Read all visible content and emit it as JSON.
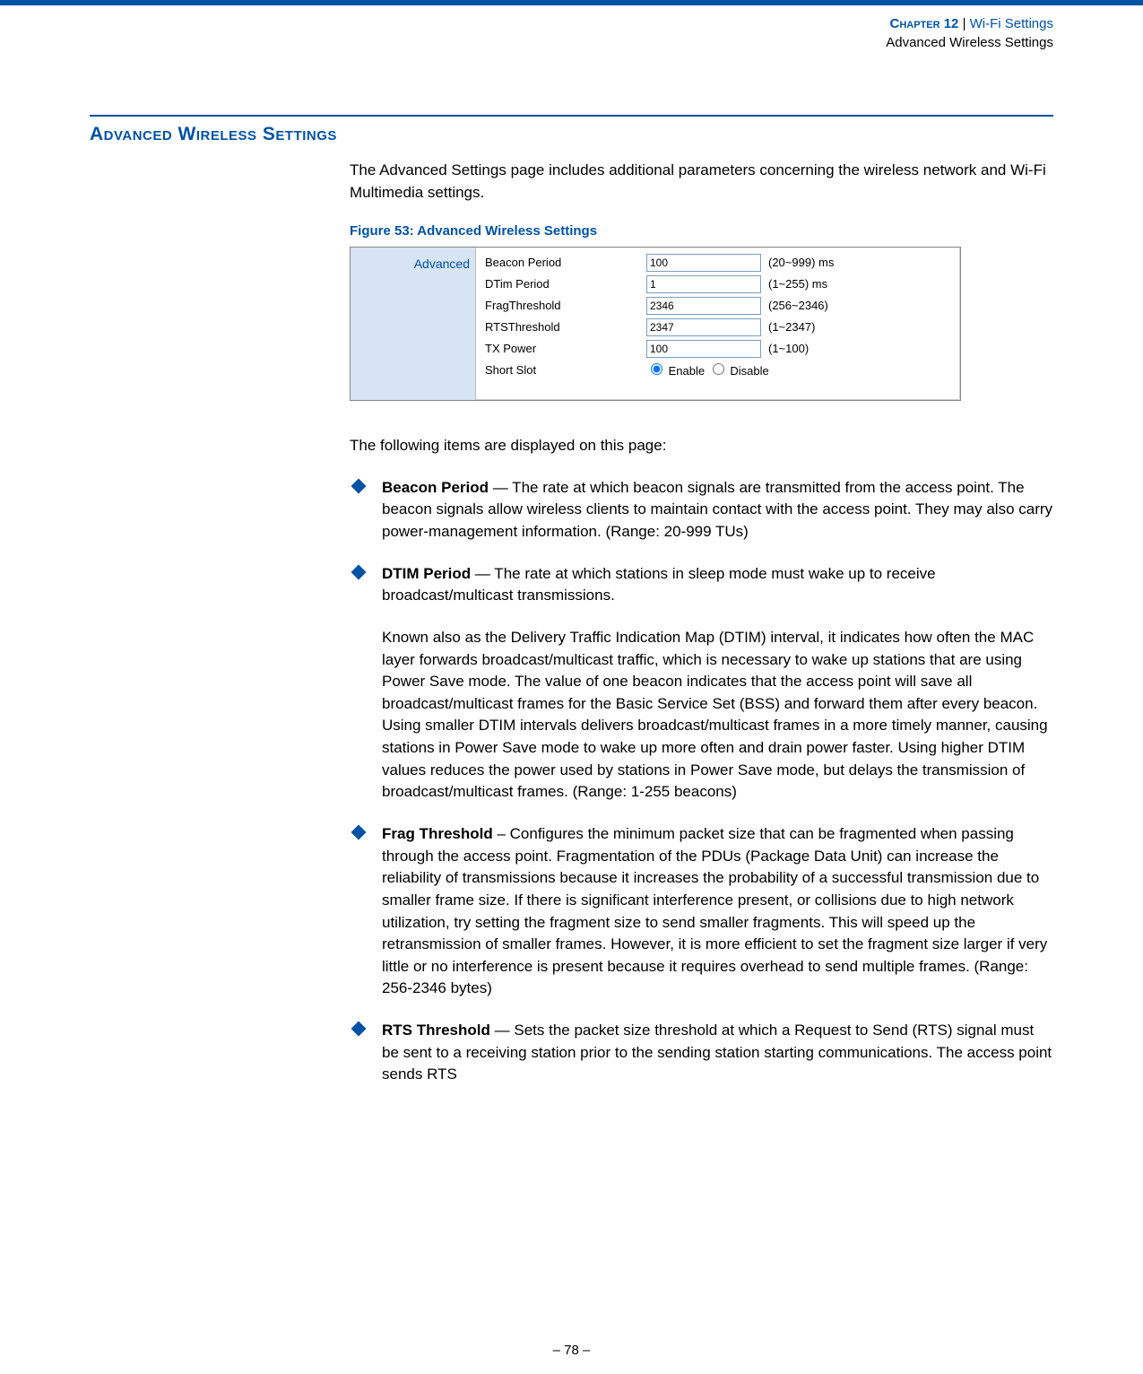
{
  "header": {
    "chapter_label": "Chapter 12",
    "separator": "  |  ",
    "section": "Wi-Fi Settings",
    "subsection": "Advanced Wireless Settings"
  },
  "section_heading": "Advanced Wireless Settings",
  "intro": "The Advanced Settings page includes additional parameters concerning the wireless network and Wi-Fi Multimedia settings.",
  "figure_caption": "Figure 53:  Advanced Wireless Settings",
  "screenshot": {
    "sidebar_label": "Advanced",
    "rows": [
      {
        "label": "Beacon Period",
        "value": "100",
        "hint": "(20~999) ms"
      },
      {
        "label": "DTim Period",
        "value": "1",
        "hint": "(1~255) ms"
      },
      {
        "label": "FragThreshold",
        "value": "2346",
        "hint": "(256~2346)"
      },
      {
        "label": "RTSThreshold",
        "value": "2347",
        "hint": "(1~2347)"
      },
      {
        "label": "TX Power",
        "value": "100",
        "hint": "(1~100)"
      }
    ],
    "short_slot": {
      "label": "Short Slot",
      "enable": "Enable",
      "disable": "Disable"
    }
  },
  "post_figure": "The following items are displayed on this page:",
  "bullets": [
    {
      "term": "Beacon Period",
      "body": " — The rate at which beacon signals are transmitted from the access point. The beacon signals allow wireless clients to maintain contact with the access point. They may also carry power-management information. (Range: 20-999 TUs)"
    },
    {
      "term": "DTIM Period",
      "body": " — The rate at which stations in sleep mode must wake up to receive broadcast/multicast transmissions.",
      "extra": "Known also as the Delivery Traffic Indication Map (DTIM) interval, it indicates how often the MAC layer forwards broadcast/multicast traffic, which is necessary to wake up stations that are using Power Save mode. The value of one beacon indicates that the access point will save all broadcast/multicast frames for the Basic Service Set (BSS) and forward them after every beacon. Using smaller DTIM intervals delivers broadcast/multicast frames in a more timely manner, causing stations in Power Save mode to wake up more often and drain power faster. Using higher DTIM values reduces the power used by stations in Power Save mode, but delays the transmission of broadcast/multicast frames. (Range: 1-255 beacons)"
    },
    {
      "term": "Frag Threshold",
      "body": " – Configures the minimum packet size that can be fragmented when passing through the access point. Fragmentation of the PDUs (Package Data Unit) can increase the reliability of transmissions because it increases the probability of a successful transmission due to smaller frame size. If there is significant interference present, or collisions due to high network utilization, try setting the fragment size to send smaller fragments. This will speed up the retransmission of smaller frames. However, it is more efficient to set the fragment size larger if very little or no interference is present because it requires overhead to send multiple frames. (Range: 256-2346 bytes)"
    },
    {
      "term": "RTS Threshold",
      "body": " — Sets the packet size threshold at which a Request to Send (RTS) signal must be sent to a receiving station prior to the sending station starting communications. The access point sends RTS"
    }
  ],
  "footer": "–  78  –"
}
